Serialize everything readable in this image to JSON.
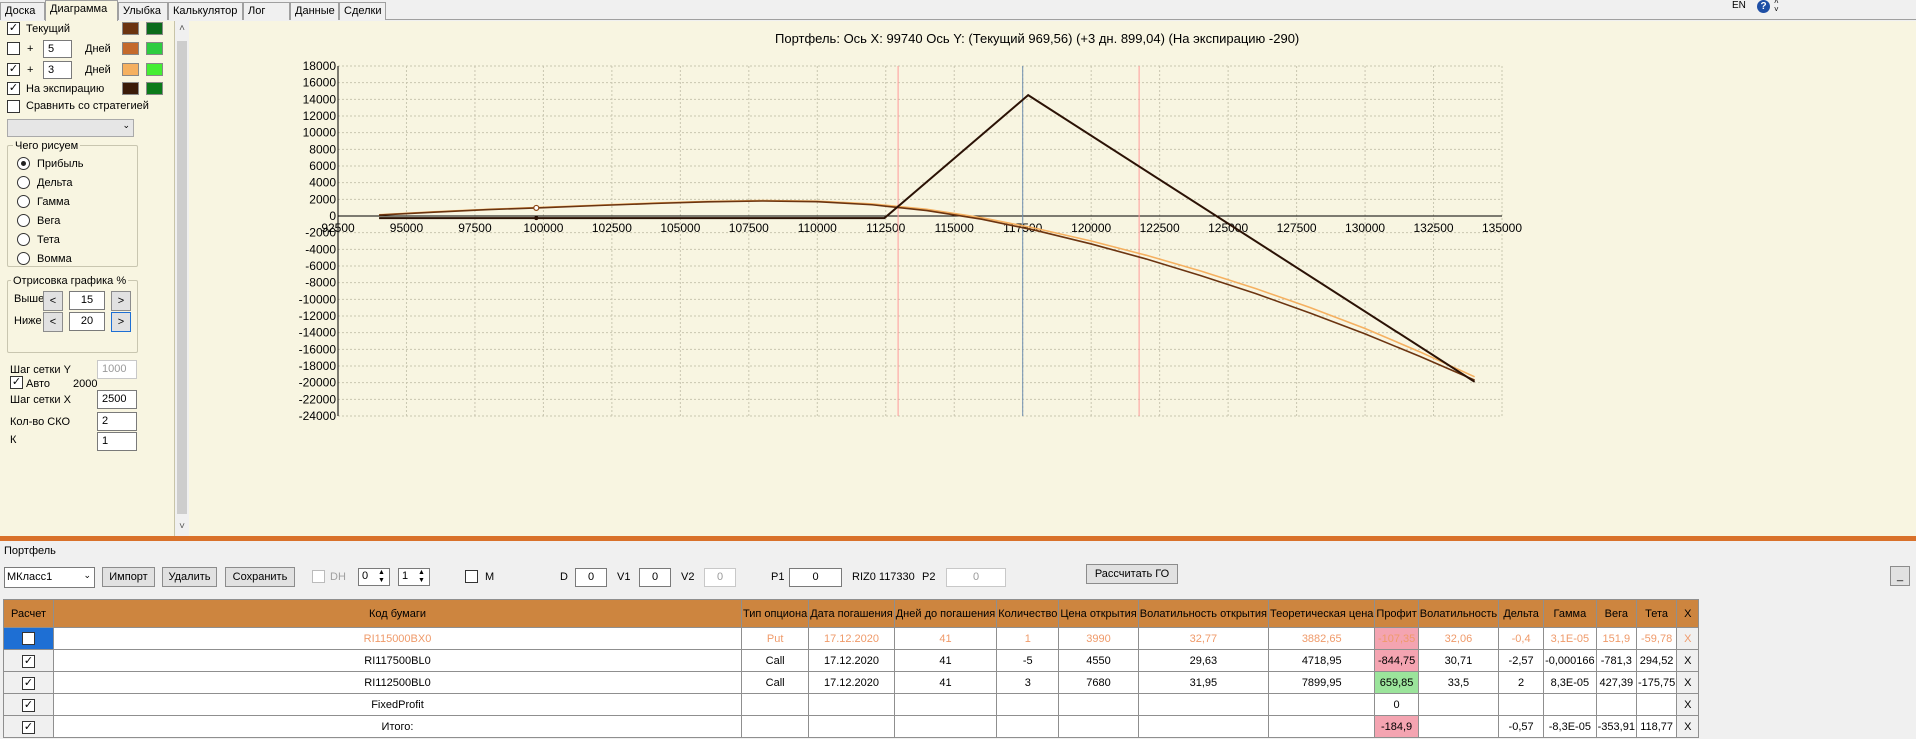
{
  "tabs": [
    "Доска",
    "Диаграмма",
    "Улыбка",
    "Калькулятор",
    "Лог",
    "Данные",
    "Сделки"
  ],
  "active_tab": "Диаграмма",
  "language": "EN",
  "left_panel": {
    "rows": [
      {
        "checked": true,
        "plus": "",
        "value": "",
        "label": "Текущий",
        "colors": [
          "#6b3410",
          "#0b6b1a"
        ]
      },
      {
        "checked": false,
        "plus": "+",
        "value": "5",
        "label": "Дней",
        "colors": [
          "#c46a2c",
          "#2ecc40"
        ]
      },
      {
        "checked": true,
        "plus": "+",
        "value": "3",
        "label": "Дней",
        "colors": [
          "#f5b060",
          "#44ee33"
        ]
      },
      {
        "checked": true,
        "plus": "",
        "value": "",
        "label": "На экспирацию",
        "colors": [
          "#3a1a08",
          "#0b7a1a"
        ]
      }
    ],
    "compare_label": "Сравнить со стратегией",
    "compare_checked": false,
    "compare_select": "",
    "draw_group": {
      "title": "Чего рисуем",
      "options": [
        "Прибыль",
        "Дельта",
        "Гамма",
        "Вега",
        "Тета",
        "Вомма"
      ],
      "selected": "Прибыль"
    },
    "render_group": {
      "title": "Отрисовка графика %",
      "above_label": "Выше",
      "above_value": "15",
      "below_label": "Ниже",
      "below_value": "20",
      "dec": "<",
      "inc": ">"
    },
    "grid_y_label": "Шаг сетки Y",
    "grid_y_value": "1000",
    "auto_label": "Авто",
    "auto_checked": true,
    "auto_value": "2000",
    "grid_x_label": "Шаг сетки X",
    "grid_x_value": "2500",
    "sko_label": "Кол-во СКО",
    "sko_value": "2",
    "cut_label": "К",
    "cut_value": "1"
  },
  "chart_header": {
    "portfolio": "Портфель:",
    "x_axis": "Ось X: 99740",
    "y_axis": "Ось Y:",
    "current": "(Текущий 969,56)",
    "plus3": "(+3 дн. 899,04)",
    "expiration": "(На экспирацию -290)"
  },
  "chart_data": {
    "type": "line",
    "title": "",
    "xlim": [
      92500,
      135000
    ],
    "ylim": [
      -24000,
      18000
    ],
    "x_ticks": [
      92500,
      95000,
      97500,
      100000,
      102500,
      105000,
      107500,
      110000,
      112500,
      115000,
      117500,
      120000,
      122500,
      125000,
      127500,
      130000,
      132500,
      135000
    ],
    "y_ticks": [
      18000,
      16000,
      14000,
      12000,
      10000,
      8000,
      6000,
      4000,
      2000,
      0,
      -2000,
      -4000,
      -6000,
      -8000,
      -10000,
      -12000,
      -14000,
      -16000,
      -18000,
      -20000,
      -22000,
      -24000
    ],
    "grid": true,
    "vertical_lines": [
      {
        "x": 112950,
        "color": "#ff9a9a"
      },
      {
        "x": 117500,
        "color": "#6f8fb0"
      },
      {
        "x": 121750,
        "color": "#ff9a9a"
      }
    ],
    "series": [
      {
        "color": "#f5b060",
        "x": [
          94000,
          96000,
          98000,
          100000,
          102000,
          104000,
          106000,
          108000,
          110000,
          112000,
          114000,
          116000,
          118000,
          120000,
          122000,
          124000,
          126000,
          128000,
          130000,
          132000,
          134000
        ],
        "y": [
          150,
          500,
          800,
          1050,
          1300,
          1550,
          1750,
          1850,
          1780,
          1450,
          800,
          -200,
          -1500,
          -3000,
          -4700,
          -6600,
          -8700,
          -11000,
          -13500,
          -16300,
          -19300
        ]
      },
      {
        "color": "#6b3410",
        "x": [
          94000,
          96000,
          98000,
          100000,
          102000,
          104000,
          106000,
          108000,
          110000,
          112000,
          114000,
          116000,
          118000,
          120000,
          122000,
          124000,
          126000,
          128000,
          130000,
          132000,
          134000
        ],
        "y": [
          120,
          460,
          770,
          1000,
          1260,
          1500,
          1700,
          1800,
          1720,
          1350,
          650,
          -380,
          -1750,
          -3350,
          -5150,
          -7150,
          -9300,
          -11650,
          -14150,
          -16850,
          -19700
        ]
      },
      {
        "color": "#2b1205",
        "x": [
          94000,
          112450,
          117700,
          134000
        ],
        "y": [
          -250,
          -250,
          14500,
          -19900
        ]
      }
    ],
    "marker": {
      "x": 99740,
      "y": 969.56
    }
  },
  "portfolio": {
    "title": "Портфель",
    "class_select": "МКласс1",
    "import": "Импорт",
    "delete": "Удалить",
    "save": "Сохранить",
    "dh": "DH",
    "spin1": "0",
    "spin2": "1",
    "m": "M",
    "d_label": "D",
    "d_value": "0",
    "v1_label": "V1",
    "v1_value": "0",
    "v2_label": "V2",
    "v2_value": "0",
    "p1_label": "P1",
    "p1_value": "0",
    "riz_text": "RIZ0 117330",
    "p2_label": "P2",
    "p2_value": "0",
    "calc_go": "Рассчитать ГО",
    "collapse": "_",
    "columns": [
      "Расчет",
      "Код бумаги",
      "Тип опциона",
      "Дата погашения",
      "Дней до погашения",
      "Количество",
      "Цена открытия",
      "Волатильность открытия",
      "Теоретическая цена",
      "Профит",
      "Волатильность",
      "Дельта",
      "Гамма",
      "Вега",
      "Тета",
      "X"
    ],
    "rows": [
      {
        "checked": false,
        "selected": true,
        "faded": true,
        "cells": [
          "RI115000BX0",
          "Put",
          "17.12.2020",
          "41",
          "1",
          "3990",
          "32,77",
          "3882,65",
          "-107,35",
          "32,06",
          "-0,4",
          "3,1E-05",
          "151,9",
          "-59,78"
        ],
        "profit_color": "red"
      },
      {
        "checked": true,
        "selected": false,
        "faded": false,
        "cells": [
          "RI117500BL0",
          "Call",
          "17.12.2020",
          "41",
          "-5",
          "4550",
          "29,63",
          "4718,95",
          "-844,75",
          "30,71",
          "-2,57",
          "-0,000166",
          "-781,3",
          "294,52"
        ],
        "profit_color": "red"
      },
      {
        "checked": true,
        "selected": false,
        "faded": false,
        "cells": [
          "RI112500BL0",
          "Call",
          "17.12.2020",
          "41",
          "3",
          "7680",
          "31,95",
          "7899,95",
          "659,85",
          "33,5",
          "2",
          "8,3E-05",
          "427,39",
          "-175,75"
        ],
        "profit_color": "green"
      },
      {
        "checked": true,
        "selected": false,
        "faded": false,
        "cells": [
          "FixedProfit",
          "",
          "",
          "",
          "",
          "",
          "",
          "",
          "0",
          "",
          "",
          "",
          "",
          ""
        ],
        "profit_color": "none"
      },
      {
        "checked": true,
        "selected": false,
        "faded": false,
        "cells": [
          "Итого:",
          "",
          "",
          "",
          "",
          "",
          "",
          "",
          "-184,9",
          "",
          "-0,57",
          "-8,3E-05",
          "-353,91",
          "118,77"
        ],
        "profit_color": "red"
      }
    ],
    "row_x": "X"
  }
}
